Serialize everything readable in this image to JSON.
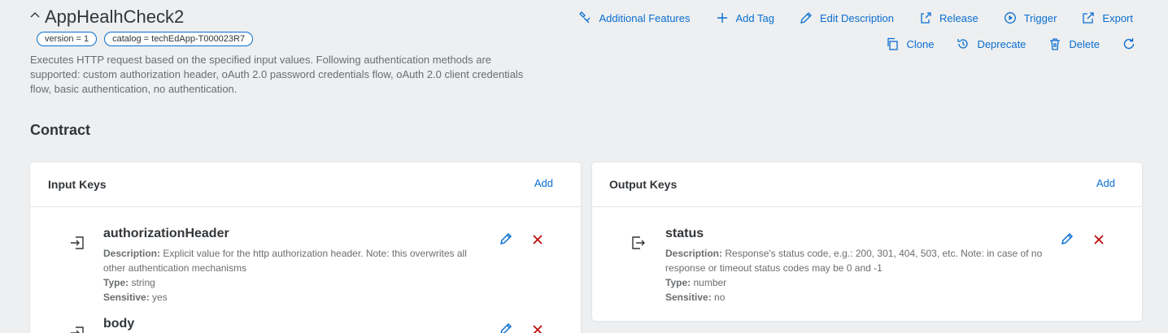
{
  "header": {
    "title": "AppHealhCheck2",
    "tags": [
      "version = 1",
      "catalog = techEdApp-T000023R7"
    ],
    "description": "Executes HTTP request based on the specified input values. Following authentication methods are supported: custom authorization header, oAuth 2.0 password credentials flow, oAuth 2.0 client credentials flow, basic authentication, no authentication."
  },
  "actions": {
    "additional_features": "Additional Features",
    "add_tag": "Add Tag",
    "edit_description": "Edit Description",
    "release": "Release",
    "trigger": "Trigger",
    "export": "Export",
    "clone": "Clone",
    "deprecate": "Deprecate",
    "delete": "Delete"
  },
  "contract": {
    "title": "Contract",
    "input": {
      "title": "Input Keys",
      "add_label": "Add",
      "items": [
        {
          "name": "authorizationHeader",
          "description_label": "Description:",
          "description": "Explicit value for the http authorization header. Note: this overwrites all other authentication mechanisms",
          "type_label": "Type:",
          "type": "string",
          "sensitive_label": "Sensitive:",
          "sensitive": "yes"
        },
        {
          "name": "body"
        }
      ]
    },
    "output": {
      "title": "Output Keys",
      "add_label": "Add",
      "items": [
        {
          "name": "status",
          "description_label": "Description:",
          "description": "Response's status code, e.g.: 200, 301, 404, 503, etc. Note: in case of no response or timeout status codes may be 0 and -1",
          "type_label": "Type:",
          "type": "number",
          "sensitive_label": "Sensitive:",
          "sensitive": "no"
        }
      ]
    }
  },
  "colors": {
    "accent": "#0a6ed1",
    "delete": "#bb0000",
    "background": "#edeff0"
  },
  "icons": {
    "collapse": "chevron-up-icon",
    "input_key": "log-in-icon",
    "output_key": "log-out-icon",
    "edit": "pencil-icon",
    "delete": "close-icon"
  }
}
